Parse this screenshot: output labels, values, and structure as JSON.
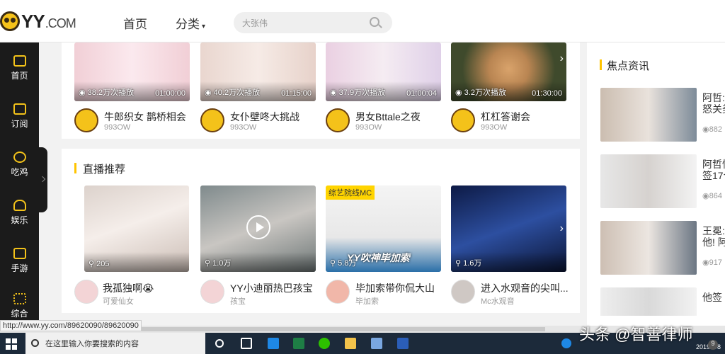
{
  "header": {
    "logo_text": "YY",
    "logo_suffix": ".COM",
    "nav_home": "首页",
    "nav_category": "分类",
    "search_placeholder": "大张伟"
  },
  "sidebar": {
    "items": [
      {
        "label": "首页",
        "icon": "home-icon"
      },
      {
        "label": "订阅",
        "icon": "subscribe-icon"
      },
      {
        "label": "吃鸡",
        "icon": "game-icon"
      },
      {
        "label": "娱乐",
        "icon": "mic-icon"
      },
      {
        "label": "手游",
        "icon": "mobile-game-icon"
      },
      {
        "label": "综合",
        "icon": "grid-icon"
      }
    ]
  },
  "videos": [
    {
      "views": "38.2万次播放",
      "duration": "01:00:00",
      "title": "牛郎织女 鹊桥相会",
      "channel": "993OW"
    },
    {
      "views": "40.2万次播放",
      "duration": "01:15:00",
      "title": "女仆壁咚大挑战",
      "channel": "993OW"
    },
    {
      "views": "37.9万次播放",
      "duration": "01:00:04",
      "title": "男女Bttale之夜",
      "channel": "993OW"
    },
    {
      "views": "3.2万次播放",
      "duration": "01:30:00",
      "title": "杠杠答谢会",
      "channel": "993OW"
    }
  ],
  "live_section": {
    "title": "直播推荐",
    "cards": [
      {
        "viewers": "205",
        "title": "我孤独啊😭",
        "streamer": "可爱仙女"
      },
      {
        "viewers": "1.0万",
        "title": "YY小迪丽热巴孩宝",
        "streamer": "孩宝"
      },
      {
        "viewers": "5.8万",
        "title": "毕加索带你侃大山",
        "streamer": "毕加索",
        "badge": "综艺院线MC",
        "caption": "YY吹神毕加索"
      },
      {
        "viewers": "1.6万",
        "title": "进入水观音的尖叫...",
        "streamer": "Mc水观音"
      }
    ]
  },
  "news": {
    "title": "焦点资讯",
    "items": [
      {
        "line1": "阿哲:",
        "line2": "怒关美",
        "views": "882"
      },
      {
        "line1": "阿哲忙",
        "line2": "签17个",
        "views": "864"
      },
      {
        "line1": "王冕:",
        "line2": "他! 阿",
        "views": "917"
      },
      {
        "line1": "他签",
        "line2": "",
        "views": ""
      }
    ]
  },
  "status_url": "http://www.yy.com/89620090/89620090",
  "taskbar": {
    "search_placeholder": "在这里输入你要搜索的内容",
    "date": "2019/9/8",
    "notification_count": "9"
  },
  "watermark": "头条 @智善律师"
}
